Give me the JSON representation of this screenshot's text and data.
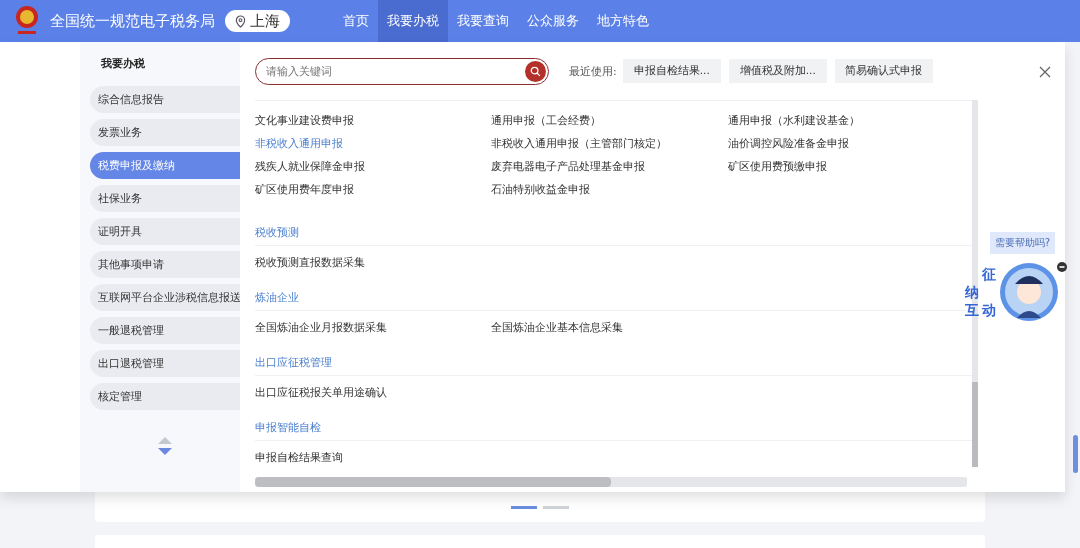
{
  "header": {
    "title": "全国统一规范电子税务局",
    "location": "上海",
    "nav": [
      {
        "label": "首页",
        "selected": false
      },
      {
        "label": "我要办税",
        "selected": true
      },
      {
        "label": "我要查询",
        "selected": false
      },
      {
        "label": "公众服务",
        "selected": false
      },
      {
        "label": "地方特色",
        "selected": false
      }
    ]
  },
  "sidebar": {
    "title": "我要办税",
    "items": [
      {
        "label": "综合信息报告",
        "selected": false
      },
      {
        "label": "发票业务",
        "selected": false
      },
      {
        "label": "税费申报及缴纳",
        "selected": true
      },
      {
        "label": "社保业务",
        "selected": false
      },
      {
        "label": "证明开具",
        "selected": false
      },
      {
        "label": "其他事项申请",
        "selected": false
      },
      {
        "label": "互联网平台企业涉税信息报送",
        "selected": false
      },
      {
        "label": "一般退税管理",
        "selected": false
      },
      {
        "label": "出口退税管理",
        "selected": false
      },
      {
        "label": "核定管理",
        "selected": false
      }
    ]
  },
  "search": {
    "placeholder": "请输入关键词"
  },
  "recent": {
    "label": "最近使用:",
    "items": [
      "申报自检结果...",
      "增值税及附加...",
      "简易确认式申报"
    ]
  },
  "sections": [
    {
      "items": [
        {
          "label": "文化事业建设费申报",
          "highlighted": false
        },
        {
          "label": "通用申报（工会经费）",
          "highlighted": false
        },
        {
          "label": "通用申报（水利建设基金）",
          "highlighted": false
        },
        {
          "label": "非税收入通用申报",
          "highlighted": true
        },
        {
          "label": "非税收入通用申报（主管部门核定）",
          "highlighted": false
        },
        {
          "label": "油价调控风险准备金申报",
          "highlighted": false
        },
        {
          "label": "残疾人就业保障金申报",
          "highlighted": false
        },
        {
          "label": "废弃电器电子产品处理基金申报",
          "highlighted": false
        },
        {
          "label": "矿区使用费预缴申报",
          "highlighted": false
        },
        {
          "label": "矿区使用费年度申报",
          "highlighted": false
        },
        {
          "label": "石油特别收益金申报",
          "highlighted": false
        }
      ]
    },
    {
      "title": "税收预测",
      "items": [
        {
          "label": "税收预测直报数据采集",
          "highlighted": false
        }
      ]
    },
    {
      "title": "炼油企业",
      "items": [
        {
          "label": "全国炼油企业月报数据采集",
          "highlighted": false
        },
        {
          "label": "全国炼油企业基本信息采集",
          "highlighted": false
        }
      ]
    },
    {
      "title": "出口应征税管理",
      "items": [
        {
          "label": "出口应征税报关单用途确认",
          "highlighted": false
        }
      ]
    },
    {
      "title": "申报智能自检",
      "items": [
        {
          "label": "申报自检结果查询",
          "highlighted": false
        }
      ]
    }
  ],
  "assistant": {
    "tooltip": "需要帮助吗?",
    "badge": [
      "征",
      "纳",
      "互",
      "动"
    ]
  }
}
